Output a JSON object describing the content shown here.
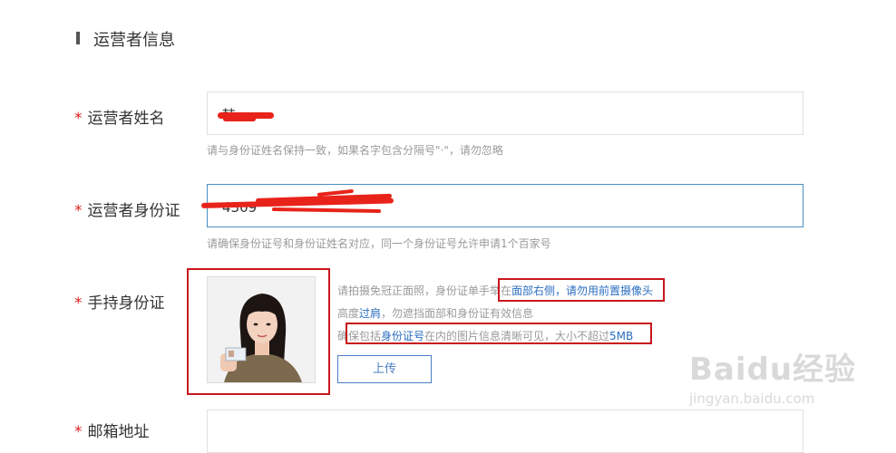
{
  "section": {
    "title": "运营者信息"
  },
  "fields": {
    "name": {
      "required_mark": "*",
      "label": "运营者姓名",
      "value": "韩",
      "hint": "请与身份证姓名保持一致，如果名字包含分隔号\"·\"，请勿忽略"
    },
    "id_number": {
      "required_mark": "*",
      "label": "运营者身份证",
      "value": "4309",
      "hint": "请确保身份证号和身份证姓名对应，同一个身份证号允许申请1个百家号"
    },
    "id_photo": {
      "required_mark": "*",
      "label": "手持身份证",
      "tip1_prefix": "请拍摄免冠正面照，身份证单手举在",
      "tip1_highlight": "面部右侧，请勿用前置摄像头",
      "tip2_prefix": "高度",
      "tip2_highlight": "过肩",
      "tip2_suffix": "，勿遮挡面部和身份证有效信息",
      "tip3_prefix": "确保包括",
      "tip3_highlight": "身份证号",
      "tip3_middle": "在内的图片信息清晰可见，大小不超过",
      "tip3_highlight2": "5MB",
      "upload_label": "上传"
    },
    "email": {
      "required_mark": "*",
      "label": "邮箱地址"
    }
  },
  "watermark": {
    "main": "Baidu经验",
    "sub": "jingyan.baidu.com"
  },
  "colors": {
    "accent": "#2a6ebf",
    "required": "#e02020",
    "annotation": "#c8161d"
  }
}
